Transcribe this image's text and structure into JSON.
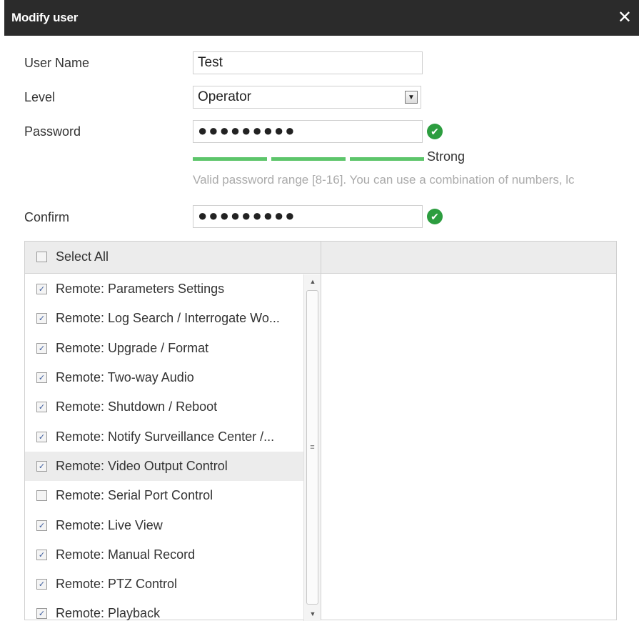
{
  "dialog": {
    "title": "Modify user",
    "close_glyph": "✕"
  },
  "form": {
    "username_label": "User Name",
    "username_value": "Test",
    "level_label": "Level",
    "level_value": "Operator",
    "password_label": "Password",
    "password_value": "●●●●●●●●●",
    "strength_label": "Strong",
    "hint": "Valid password range [8-16]. You can use a combination of numbers, lc",
    "confirm_label": "Confirm",
    "confirm_value": "●●●●●●●●●",
    "ok_icon": "check-circle-icon",
    "accent_color": "#2c9d3f"
  },
  "permissions": {
    "select_all_label": "Select All",
    "items": [
      {
        "label": "Remote: Parameters Settings",
        "checked": true
      },
      {
        "label": "Remote: Log Search / Interrogate Wo...",
        "checked": true
      },
      {
        "label": "Remote: Upgrade / Format",
        "checked": true
      },
      {
        "label": "Remote: Two-way Audio",
        "checked": true
      },
      {
        "label": "Remote: Shutdown / Reboot",
        "checked": true
      },
      {
        "label": "Remote: Notify Surveillance Center /...",
        "checked": true
      },
      {
        "label": "Remote: Video Output Control",
        "checked": true,
        "highlighted": true
      },
      {
        "label": "Remote: Serial Port Control",
        "checked": false
      },
      {
        "label": "Remote: Live View",
        "checked": true
      },
      {
        "label": "Remote: Manual Record",
        "checked": true
      },
      {
        "label": "Remote: PTZ Control",
        "checked": true
      },
      {
        "label": "Remote: Playback",
        "checked": true
      }
    ]
  }
}
